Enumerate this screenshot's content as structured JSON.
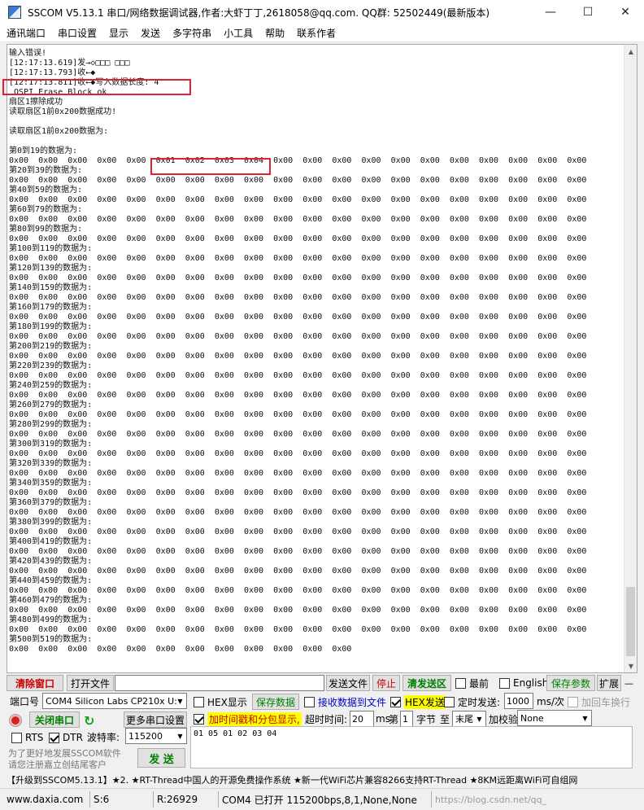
{
  "window": {
    "title": "SSCOM V5.13.1 串口/网络数据调试器,作者:大虾丁丁,2618058@qq.com. QQ群: 52502449(最新版本)",
    "minimize": "—",
    "maximize": "☐",
    "close": "✕"
  },
  "menu": [
    "通讯端口",
    "串口设置",
    "显示",
    "发送",
    "多字符串",
    "小工具",
    "帮助",
    "联系作者"
  ],
  "terminal": {
    "header_lines": [
      "输入错误!",
      "[12:17:13.619]发→◇□□□ □□□",
      "[12:17:13.793]收←◆",
      "[12:17:13.811]收←◆写入数据长度: 4",
      " QSPI Erase Block ok",
      "扇区1擦除成功",
      "读取扇区1前0x200数据成功!",
      "",
      "读取扇区1前0x200数据为:",
      "",
      "第0到19的数据为:"
    ],
    "row_headers": [
      "第0到19的数据为:",
      "第20到39的数据为:",
      "第40到59的数据为:",
      "第60到79的数据为:",
      "第80到99的数据为:",
      "第100到119的数据为:",
      "第120到139的数据为:",
      "第140到159的数据为:",
      "第160到179的数据为:",
      "第180到199的数据为:",
      "第200到219的数据为:",
      "第220到239的数据为:",
      "第240到259的数据为:",
      "第260到279的数据为:",
      "第280到299的数据为:",
      "第300到319的数据为:",
      "第320到339的数据为:",
      "第340到359的数据为:",
      "第360到379的数据为:",
      "第380到399的数据为:",
      "第400到419的数据为:",
      "第420到439的数据为:",
      "第440到459的数据为:",
      "第460到479的数据为:",
      "第480到499的数据为:",
      "第500到519的数据为:"
    ],
    "first_row": "0x00  0x00  0x00  0x00  0x00  0x01  0x02  0x03  0x04  0x00  0x00  0x00  0x00  0x00  0x00  0x00  0x00  0x00  0x00  0x00",
    "zero_row": "0x00  0x00  0x00  0x00  0x00  0x00  0x00  0x00  0x00  0x00  0x00  0x00  0x00  0x00  0x00  0x00  0x00  0x00  0x00  0x00",
    "last_row": "0x00  0x00  0x00  0x00  0x00  0x00  0x00  0x00  0x00  0x00  0x00  0x00",
    "scroll_up": "▲",
    "scroll_down": "▼"
  },
  "toolbar1": {
    "clear_window": "清除窗口",
    "open_file": "打开文件",
    "file_path": "",
    "send_file": "发送文件",
    "stop": "停止",
    "clear_send": "清发送区",
    "topmost": "最前",
    "english": "English",
    "save_params": "保存参数",
    "expand": "扩展",
    "dash": "—"
  },
  "panel": {
    "port_label": "端口号",
    "port_value": "COM4 Silicon Labs CP210x U:",
    "hex_display": "HEX显示",
    "save_data": "保存数据",
    "recv_to_file": "接收数据到文件",
    "hex_send": "HEX发送",
    "timed_send": "定时发送:",
    "interval": "1000",
    "interval_unit": "ms/次",
    "add_crlf": "加回车换行",
    "close_port": "关闭串口",
    "more_settings": "更多串口设置",
    "add_timestamp": "加时间戳和分包显示,",
    "timeout_label": "超时时间:",
    "timeout_value": "20",
    "timeout_unit": "ms",
    "nth_label": "第",
    "nth_value": "1",
    "byte_label": "字节",
    "to_label": "至",
    "to_value": "末尾",
    "checksum_label": "加校验",
    "checksum_value": "None",
    "rts": "RTS",
    "dtr": "DTR",
    "baud_label": "波特率:",
    "baud_value": "115200",
    "send_text": "01 05 01 02 03 04",
    "promo_line1": "为了更好地发展SSCOM软件",
    "promo_line2": "请您注册嘉立创结尾客户",
    "send_button": "发 送"
  },
  "ticker": "【升级到SSCOM5.13.1】★2. ★RT-Thread中国人的开源免费操作系统 ★新一代WiFi芯片兼容8266支持RT-Thread ★8KM远距离WiFi可自组网",
  "status": {
    "website": "www.daxia.com",
    "sent": "S:6",
    "received": "R:26929",
    "port_info": "COM4 已打开  115200bps,8,1,None,None",
    "watermark": "https://blog.csdn.net/qq_"
  },
  "colors": {
    "highlight_box": "#e3202f",
    "red_button_text": "#cc0000",
    "green_text": "#008000",
    "yellow_bg": "#ffff00",
    "blue_text": "#0000cc"
  }
}
